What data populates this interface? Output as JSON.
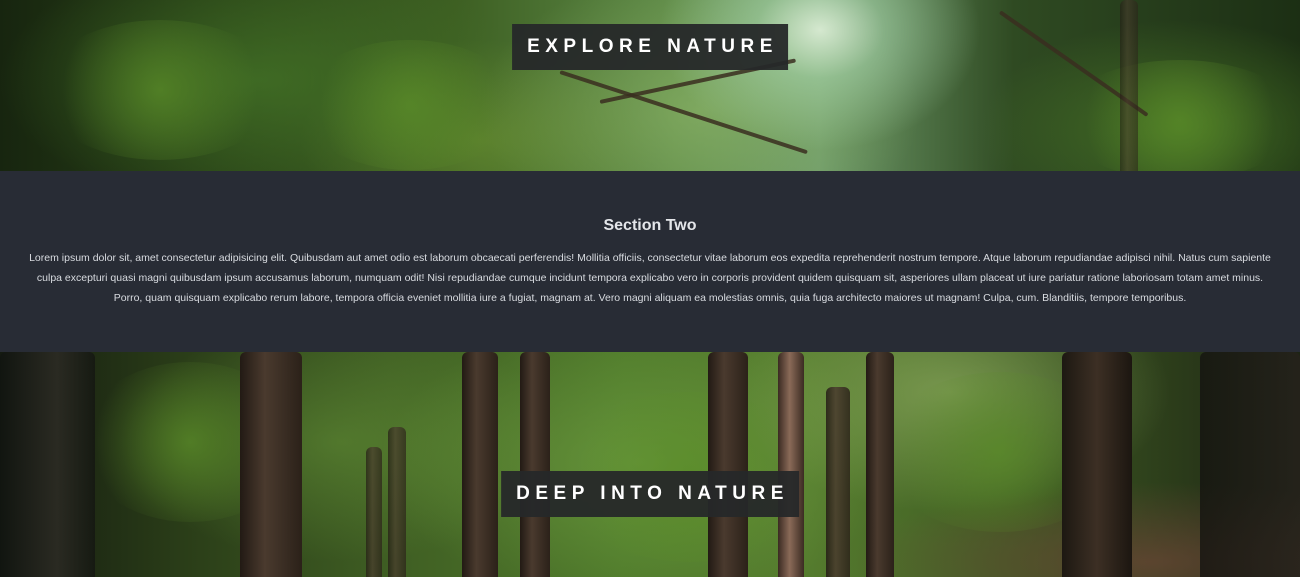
{
  "sections": {
    "top_hero": {
      "title": "Explore Nature"
    },
    "section_two": {
      "heading": "Section Two",
      "body": "Lorem ipsum dolor sit, amet consectetur adipisicing elit. Quibusdam aut amet odio est laborum obcaecati perferendis! Mollitia officiis, consectetur vitae laborum eos expedita reprehenderit nostrum tempore. Atque laborum repudiandae adipisci nihil. Natus cum sapiente culpa excepturi quasi magni quibusdam ipsum accusamus laborum, numquam odit! Nisi repudiandae cumque incidunt tempora explicabo vero in corporis provident quidem quisquam sit, asperiores ullam placeat ut iure pariatur ratione laboriosam totam amet minus. Porro, quam quisquam explicabo rerum labore, tempora officia eveniet mollitia iure a fugiat, magnam at. Vero magni aliquam ea molestias omnis, quia fuga architecto maiores ut magnam! Culpa, cum. Blanditiis, tempore temporibus."
    },
    "bottom_hero": {
      "title": "Deep Into Nature"
    }
  },
  "colors": {
    "section_background": "#282c35",
    "title_box_background": "#262829",
    "text": "#ffffff"
  }
}
